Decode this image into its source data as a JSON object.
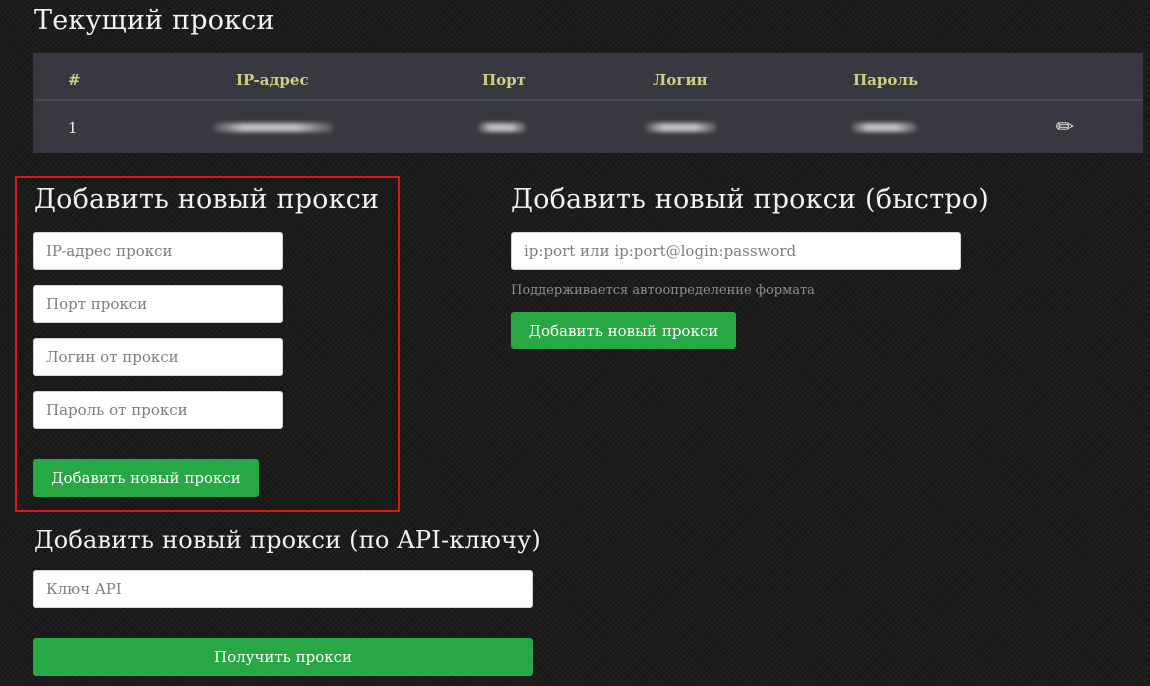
{
  "current_proxy": {
    "title": "Текущий прокси",
    "columns": [
      "#",
      "IP-адрес",
      "Порт",
      "Логин",
      "Пароль"
    ],
    "row": {
      "number": "1"
    },
    "edit_icon": "pencil-icon"
  },
  "add_proxy": {
    "title": "Добавить новый прокси",
    "ip_placeholder": "IP-адрес прокси",
    "port_placeholder": "Порт прокси",
    "login_placeholder": "Логин от прокси",
    "password_placeholder": "Пароль от прокси",
    "submit_label": "Добавить новый прокси"
  },
  "add_proxy_fast": {
    "title": "Добавить новый прокси (быстро)",
    "placeholder": "ip:port или ip:port@login:password",
    "help": "Поддерживается автоопределение формата",
    "submit_label": "Добавить новый прокси"
  },
  "add_proxy_api": {
    "title": "Добавить новый прокси (по API-ключу)",
    "placeholder": "Ключ API",
    "submit_label": "Получить прокси"
  },
  "colors": {
    "button_green": "#28a745",
    "highlight_red": "#e0141c",
    "table_header_text": "#cfcf7f",
    "table_bg": "#363a40"
  }
}
